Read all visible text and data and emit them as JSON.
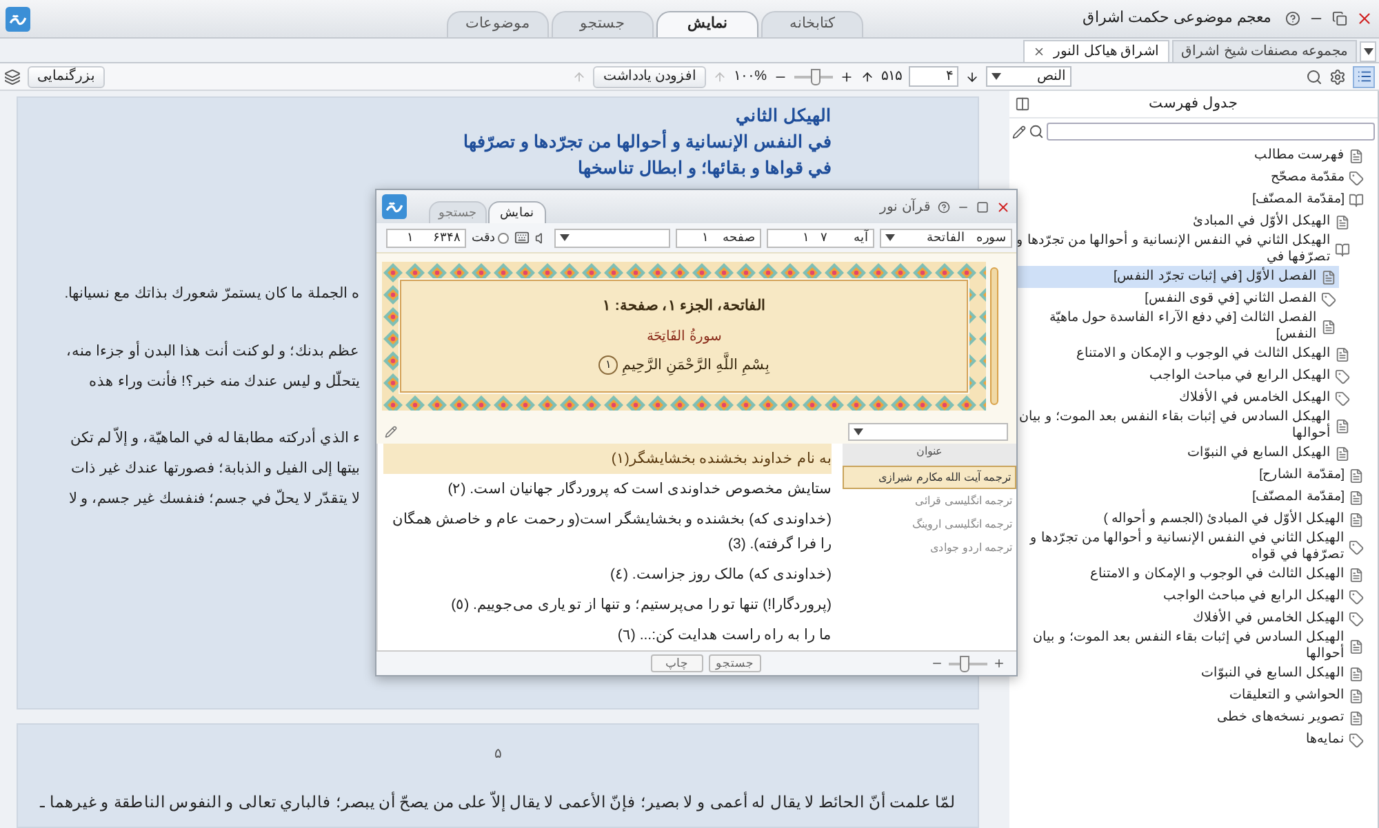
{
  "app": {
    "title": "معجم موضوعی حکمت اشراق",
    "tabs": [
      {
        "label": "کتابخانه",
        "selected": false
      },
      {
        "label": "نمایش",
        "selected": true
      },
      {
        "label": "جستجو",
        "selected": false
      },
      {
        "label": "موضوعات",
        "selected": false
      }
    ]
  },
  "doc_tabs": [
    {
      "label": "مجموعه مصنفات شیخ اشراق",
      "selected": false
    },
    {
      "label": "اشراق هیاکل النور",
      "selected": true
    }
  ],
  "toolbar": {
    "view": "النص",
    "page": "۴",
    "page_count": "۵۱۵",
    "zoom": {
      "level": 0.52,
      "reading": "۱۰۰%"
    },
    "add_note": "افزودن یادداشت",
    "magnify": "بزرگنمایی"
  },
  "page": {
    "heading": [
      "الهيكل الثاني",
      "في النفس الإنسانية و أحوالها من تجرّدها و تصرّفها",
      "في قواها و بقائها؛ و ابطال تناسخها"
    ],
    "paragraphs": [
      [
        "ه الجملة ما كان يستمرّ شعورك بذاتك مع نسيانها."
      ],
      [
        "عظم بدنك؛ و لو كنت أنت هذا البدن أو جزءا منه،",
        "يتحلّل و ليس عندك منه خبر؟! فأنت وراء هذه"
      ],
      [
        "ء الذي أدركته مطابقا له في الماهيّة، و إلاّ لم تكن",
        "بيتها إلى الفيل و الذبابة؛ فصورتها عندك غير ذات",
        "لا يتقدّر لا يحلّ في جسم؛ فنفسك غير جسم، و لا"
      ]
    ],
    "page_number": "۵",
    "next_text": "لمّا علمت أنّ الحائط لا يقال له أعمى و لا بصير؛ فإنّ الأعمى لا يقال إلاّ على من يصحّ أن يبصر؛ فالباري تعالى و النفوس الناطقة و غيرهما ـ"
  },
  "toc": {
    "title": "جدول فهرست",
    "items": [
      {
        "label": "فهرست مطالب",
        "kind": "doc",
        "selected": false
      },
      {
        "label": "مقدّمة مصحّح",
        "kind": "tag",
        "selected": false
      },
      {
        "label": "[مقدّمة المصنّف]",
        "kind": "book",
        "selected": false,
        "children": [
          {
            "label": "الهيكل الأوّل في المبادئ",
            "kind": "doc",
            "selected": false
          },
          {
            "label": "الهيكل الثاني في النفس الإنسانية و أحوالها من تجرّدها و تصرّفها في",
            "kind": "book",
            "selected": false,
            "children": [
              {
                "label": "الفصل الأوّل [في إثبات تجرّد النفس]",
                "kind": "doc",
                "selected": true
              },
              {
                "label": "الفصل الثاني [في قوى النفس]",
                "kind": "tag",
                "selected": false
              },
              {
                "label": "الفصل الثالث [في دفع الآراء الفاسدة حول ماهيّة النفس]",
                "kind": "doc",
                "selected": false
              }
            ]
          },
          {
            "label": "الهيكل الثالث في الوجوب و الإمكان و الامتناع",
            "kind": "doc",
            "selected": false
          },
          {
            "label": "الهيكل الرابع في مباحث الواجب",
            "kind": "tag",
            "selected": false
          },
          {
            "label": "الهيكل الخامس في الأفلاك",
            "kind": "tag",
            "selected": false
          },
          {
            "label": "الهيكل السادس في إثبات بقاء النفس بعد الموت؛ و بيان أحوالها",
            "kind": "doc",
            "selected": false
          },
          {
            "label": "الهيكل السابع في النبوّات",
            "kind": "doc",
            "selected": false
          }
        ]
      },
      {
        "label": "[مقدّمة الشارح]",
        "kind": "doc",
        "selected": false
      },
      {
        "label": "[مقدّمة المصنّف]",
        "kind": "doc",
        "selected": false
      },
      {
        "label": "الهيكل الأوّل في المبادئ (الجسم و أحواله )",
        "kind": "doc",
        "selected": false
      },
      {
        "label": "الهيكل الثاني في النفس الإنسانية و أحوالها من تجرّدها و تصرّفها في قواه",
        "kind": "tag",
        "selected": false
      },
      {
        "label": "الهيكل الثالث في الوجوب و الإمكان و الامتناع",
        "kind": "doc",
        "selected": false
      },
      {
        "label": "الهيكل الرابع في مباحث الواجب",
        "kind": "tag",
        "selected": false
      },
      {
        "label": "الهيكل الخامس في الأفلاك",
        "kind": "tag",
        "selected": false
      },
      {
        "label": "الهيكل السادس في إثبات بقاء النفس بعد الموت؛ و بيان أحوالها",
        "kind": "doc",
        "selected": false
      },
      {
        "label": "الهيكل السابع في النبوّات",
        "kind": "doc",
        "selected": false
      },
      {
        "label": "الحواشي و التعليقات",
        "kind": "doc",
        "selected": false
      },
      {
        "label": "تصویر نسخه‌های خطی",
        "kind": "doc",
        "selected": false
      },
      {
        "label": "نمایه‌ها",
        "kind": "tag",
        "selected": false
      }
    ]
  },
  "dialog": {
    "title": "قرآن نور",
    "tabs": [
      {
        "label": "نمایش",
        "selected": true
      },
      {
        "label": "جستجو",
        "selected": false
      }
    ],
    "surah_label": "سوره",
    "surah": "الفاتحة",
    "ayah_label": "آیه",
    "ayah_total": "۷",
    "ayah": "۱",
    "page_label": "صفحه",
    "page": "۱",
    "precise": {
      "label": "دقت",
      "checked": false
    },
    "total": "۶۳۴۸",
    "current": "۱",
    "header": "الفاتحة، الجزء ۱، صفحة: ۱",
    "surah_title": "سورةُ الفَاتِحَة",
    "basmala": "بِسْمِ اللَّهِ الرَّحْمَنِ الرَّحِيمِ",
    "verse_mark": "۱",
    "verses": [
      {
        "text": "به نام خداوند بخشنده بخشایشگر(۱)",
        "selected": true
      },
      {
        "text": "ستایش مخصوص خداوندی است که پروردگار جهانیان است. (۲)",
        "selected": false
      },
      {
        "text": "(خداوندی که) بخشنده و بخشایشگر است(و رحمت عام و خاصش همگان را فرا گرفته). (3)",
        "selected": false
      },
      {
        "text": "(خداوندی که) مالک روز جزاست. (٤)",
        "selected": false
      },
      {
        "text": "(پروردگارا!) تنها تو را می‌پرستیم؛ و تنها از تو یاری می‌جوییم. (٥)",
        "selected": false
      },
      {
        "text": "ما را به راه راست هدایت کن:... (٦)",
        "selected": false
      }
    ],
    "translations_header": "عنوان",
    "translations": [
      {
        "label": "ترجمه آیت الله مکارم شیرازی",
        "selected": true
      },
      {
        "label": "ترجمه انگلیسی قرائی",
        "selected": false
      },
      {
        "label": "ترجمه انگلیسی اروینگ",
        "selected": false
      },
      {
        "label": "ترجمه اردو جوادی",
        "selected": false
      }
    ],
    "buttons": [
      "جستجو",
      "چاپ"
    ],
    "zoom": {
      "level": 0.4
    }
  }
}
